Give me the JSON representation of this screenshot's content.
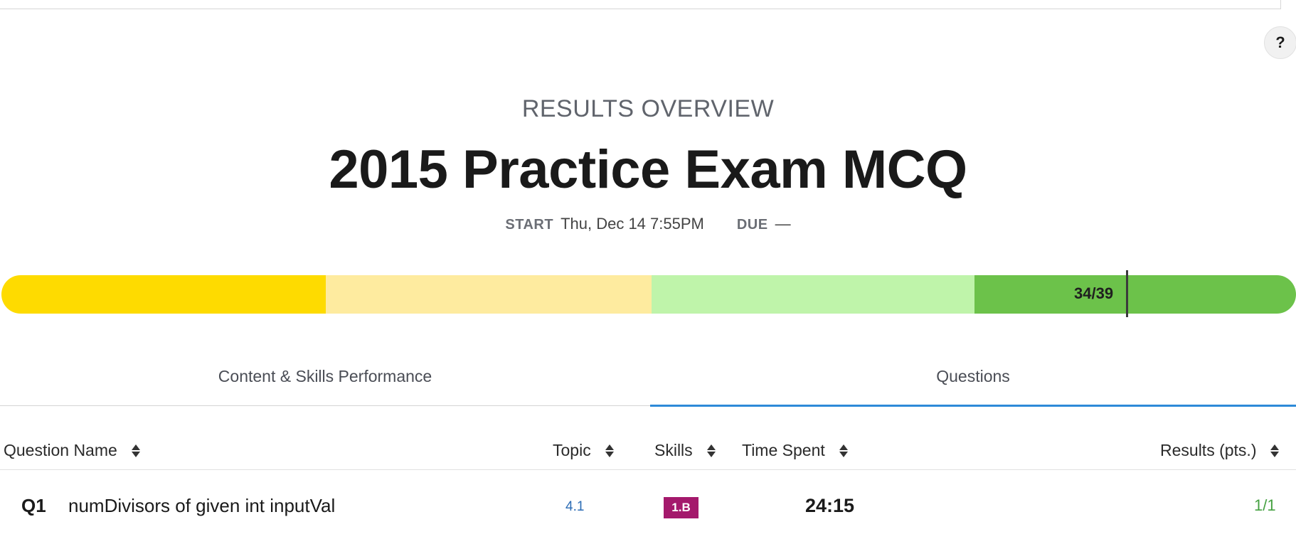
{
  "help": {
    "label": "?"
  },
  "header": {
    "overline": "RESULTS OVERVIEW",
    "title": "2015 Practice Exam MCQ",
    "start_label": "START",
    "start_value": "Thu, Dec 14 7:55PM",
    "due_label": "DUE",
    "due_value": "—"
  },
  "score": {
    "label": "34/39",
    "earned": 34,
    "total": 39,
    "band_colors": [
      "#fedb00",
      "#feeb9f",
      "#bff4aa",
      "#6cc24a"
    ]
  },
  "tabs": [
    {
      "label": "Content & Skills Performance",
      "active": false
    },
    {
      "label": "Questions",
      "active": true
    }
  ],
  "table": {
    "columns": [
      "Question Name",
      "Topic",
      "Skills",
      "Time Spent",
      "Results (pts.)"
    ],
    "rows": [
      {
        "number": "Q1",
        "name": "numDivisors of given int inputVal",
        "topic": "4.1",
        "skill": "1.B",
        "time": "24:15",
        "result": "1/1"
      }
    ]
  },
  "colors": {
    "accent": "#2d8ad8",
    "skill_badge": "#a4196c",
    "result_ok": "#46a142",
    "topic_link": "#2d6db5"
  }
}
